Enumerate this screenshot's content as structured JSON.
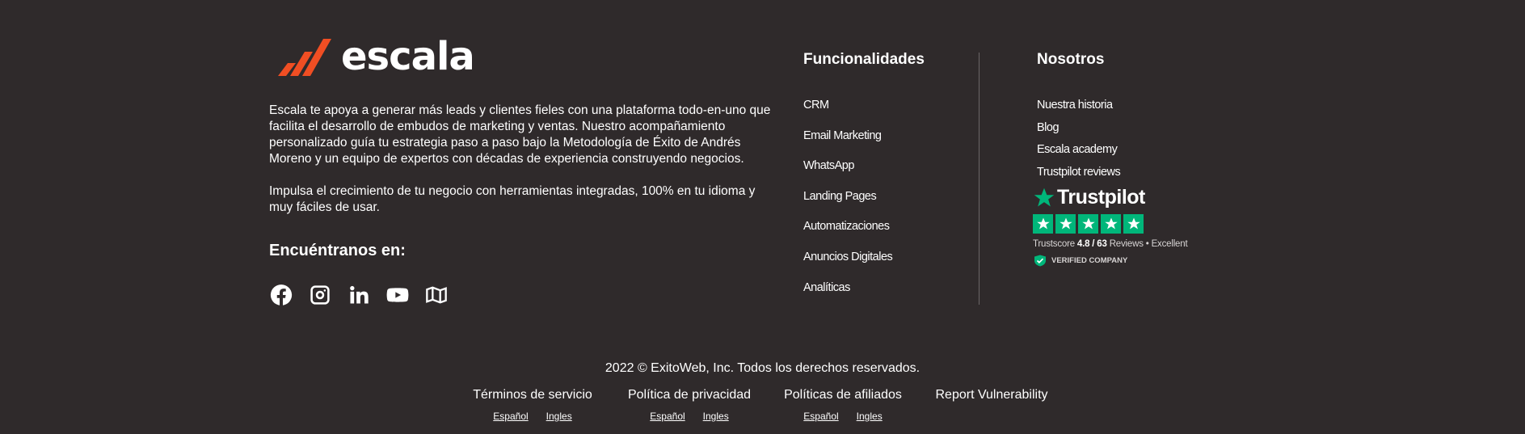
{
  "brand": {
    "name": "escala",
    "accent_color": "#f04e23",
    "description_1": "Escala te apoya a generar más leads y clientes fieles con una plataforma todo-en-uno que facilita el desarrollo de embudos de marketing y ventas. Nuestro acompañamiento personalizado guía tu estrategia paso a paso bajo la Metodología de Éxito de Andrés Moreno y un equipo de expertos con décadas de experiencia construyendo negocios.",
    "description_2": "Impulsa el crecimiento de tu negocio con herramientas integradas, 100% en tu idioma y muy fáciles de usar."
  },
  "social": {
    "title": "Encuéntranos en:",
    "icons": [
      "facebook-icon",
      "instagram-icon",
      "linkedin-icon",
      "youtube-icon",
      "map-icon"
    ]
  },
  "funcionalidades": {
    "title": "Funcionalidades",
    "items": [
      "CRM",
      "Email Marketing",
      "WhatsApp",
      "Landing Pages",
      "Automatizaciones",
      "Anuncios Digitales",
      "Analíticas"
    ]
  },
  "nosotros": {
    "title": "Nosotros",
    "items": [
      "Nuestra historia",
      "Blog",
      "Escala academy",
      "Trustpilot reviews"
    ]
  },
  "trustpilot": {
    "wordmark": "Trustpilot",
    "star_color": "#00b67a",
    "score_label": "Trustscore",
    "score": "4.8",
    "separator": "/",
    "reviews_count": "63",
    "reviews_label": "Reviews",
    "rating_word": "Excellent",
    "verified": "VERIFIED COMPANY"
  },
  "footer": {
    "copyright": "2022 © ExitoWeb, Inc. Todos los derechos reservados.",
    "links": [
      {
        "label": "Términos de servicio",
        "lang_es": "Español",
        "lang_en": "Ingles"
      },
      {
        "label": "Política de privacidad",
        "lang_es": "Español",
        "lang_en": "Ingles"
      },
      {
        "label": "Políticas de afiliados",
        "lang_es": "Español",
        "lang_en": "Ingles"
      },
      {
        "label": "Report Vulnerability"
      }
    ]
  }
}
